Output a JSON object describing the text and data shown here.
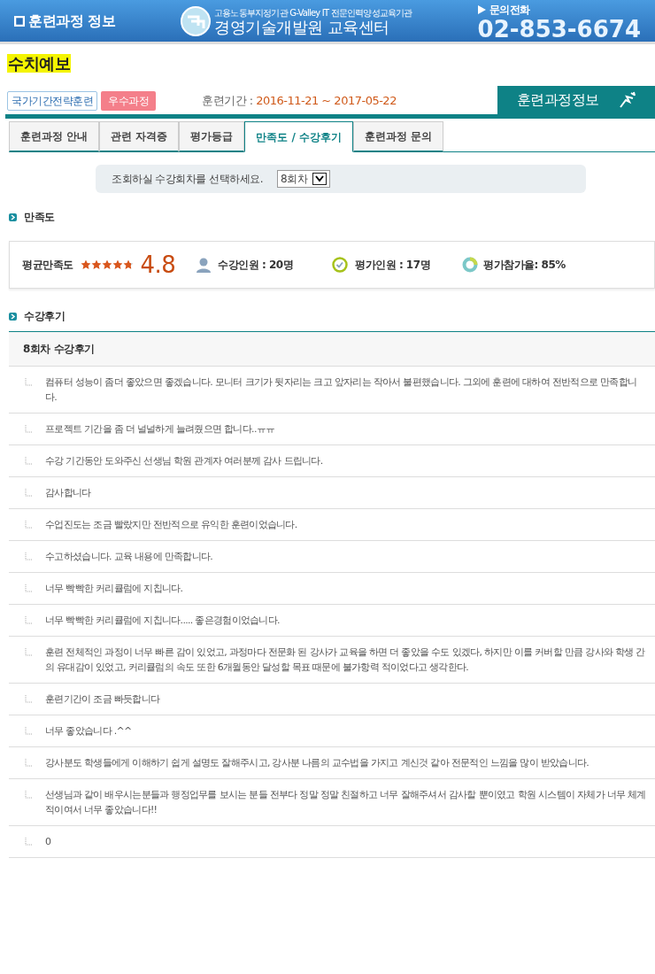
{
  "header": {
    "title": "훈련과정 정보",
    "org_subtitle": "고용노동부지정기관 G-Valley IT 전문인력양성교육기관",
    "org_name": "경영기술개발원 교육센터",
    "contact_label": "문의전화",
    "phone": "02-853-6674"
  },
  "course": {
    "title": "수치예보",
    "badges": [
      {
        "label": "국가기간전략훈련",
        "kind": "outline"
      },
      {
        "label": "우수과정",
        "kind": "filled"
      }
    ],
    "period_label": "훈련기간 : ",
    "period": "2016-11-21 ~ 2017-05-22",
    "banner": "훈련과정정보"
  },
  "tabs": [
    {
      "label": "훈련과정 안내",
      "selected": false
    },
    {
      "label": "관련 자격증",
      "selected": false
    },
    {
      "label": "평가등급",
      "selected": false
    },
    {
      "label": "만족도 / 수강후기",
      "selected": true
    },
    {
      "label": "훈련과정 문의",
      "selected": false
    }
  ],
  "round_select": {
    "label": "조회하실 수강회차를 선택하세요.",
    "value": "8회차"
  },
  "satisfaction": {
    "heading": "만족도",
    "label": "평균만족도",
    "stars": 4.8,
    "score": "4.8",
    "enrolled": "수강인원 : 20명",
    "evaluated": "평가인원 : 17명",
    "rate": "평가참가율: 85%"
  },
  "reviews": {
    "heading": "수강후기",
    "title": "8회차 수강후기",
    "items": [
      "컴퓨터 성능이 좀더 좋았으면 좋겠습니다. 모니터 크기가 뒷자리는 크고 앞자리는 작아서 불편했습니다. 그외에 훈련에 대하여 전반적으로 만족합니다.",
      "프로젝트 기간을 좀 더 널널하게 늘려줬으면 합니다..ㅠㅠ",
      "수강 기간동안 도와주신 선생님 학원 관계자 여러분께 감사 드립니다.",
      "감사합니다",
      "수업진도는 조금 빨랐지만 전반적으로 유익한 훈련이었습니다.",
      "수고하셨습니다. 교육 내용에 만족합니다.",
      "너무 빡빡한 커리큘럼에 지칩니다.",
      "너무 빡빡한 커리큘럼에 지칩니다..... 좋은경험이었습니다.",
      "훈련 전체적인 과정이 너무 빠른 감이 있었고, 과정마다 전문화 된 강사가 교육을 하면 더 좋았을 수도 있겠다, 하지만 이를 커버할 만큼 강사와 학생 간의 유대감이 있었고, 커리큘럼의 속도 또한 6개월동안 달성할 목표 때문에 불가항력 적이었다고 생각한다.",
      "훈련기간이 조금 빠듯합니다",
      "너무 좋았습니다 .^^",
      "강사분도 학생들에게 이해하기 쉽게 설명도 잘해주시고, 강사분 나름의 교수법을 가지고 계신것 같아 전문적인 느낌을 많이 받았습니다.",
      "선생님과 같이 배우시는분들과 행정업무를 보시는 분들 전부다 정말 정말 친절하고 너무 잘해주셔서 감사할 뿐이였고 학원 시스템이 자체가 너무 체계적이여서 너무 좋았습니다!!",
      "0"
    ]
  }
}
